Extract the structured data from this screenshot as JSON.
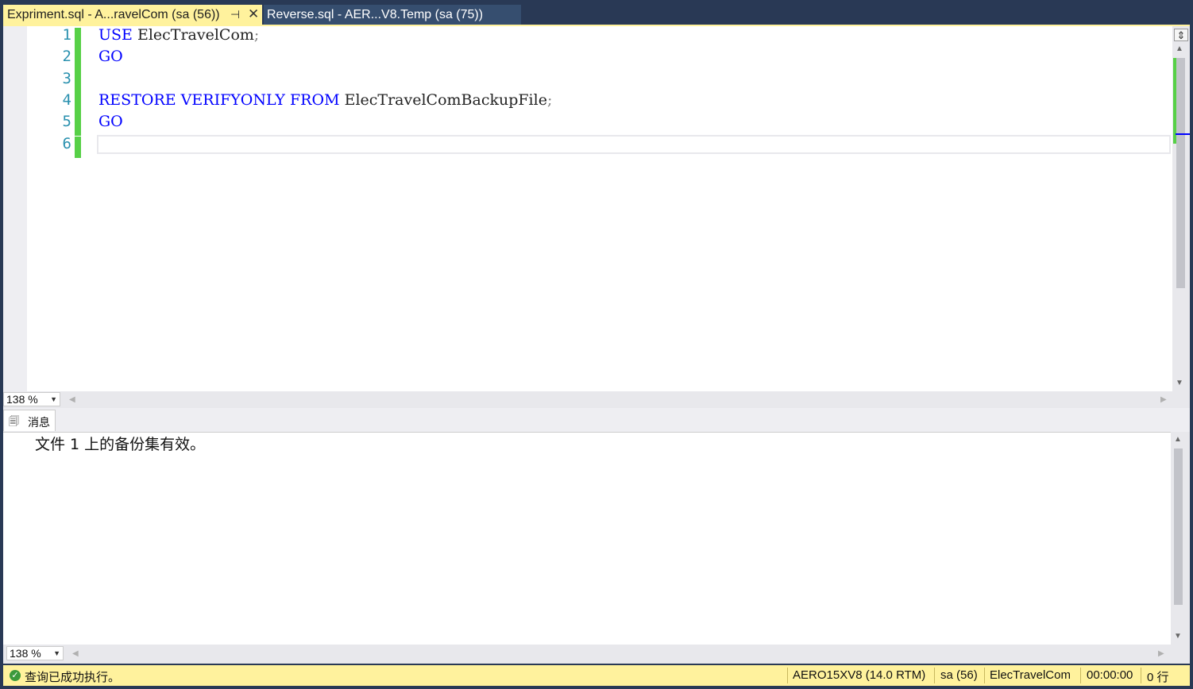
{
  "tabs": {
    "active": {
      "title": "Expriment.sql - A...ravelCom (sa (56))",
      "pin_icon": "pin-icon",
      "close_icon": "close-icon"
    },
    "inactive": {
      "title": "Reverse.sql - AER...V8.Temp (sa (75))"
    }
  },
  "editor": {
    "line_numbers": [
      "1",
      "2",
      "3",
      "4",
      "5",
      "6"
    ],
    "lines": [
      {
        "tokens": [
          {
            "t": "USE",
            "k": true
          },
          {
            "t": " ElecTravelCom",
            "k": false
          },
          {
            "t": ";",
            "p": true
          }
        ]
      },
      {
        "tokens": [
          {
            "t": "GO",
            "k": true
          }
        ]
      },
      {
        "tokens": []
      },
      {
        "tokens": [
          {
            "t": "RESTORE",
            "k": true
          },
          {
            "t": " ",
            "k": false
          },
          {
            "t": "VERIFYONLY",
            "k": true
          },
          {
            "t": " ",
            "k": false
          },
          {
            "t": "FROM",
            "k": true
          },
          {
            "t": " ElecTravelComBackupFile",
            "k": false
          },
          {
            "t": ";",
            "p": true
          }
        ]
      },
      {
        "tokens": [
          {
            "t": "GO",
            "k": true
          }
        ]
      },
      {
        "tokens": []
      }
    ],
    "zoom": "138 %"
  },
  "results": {
    "tab_label": "消息",
    "message": "文件 1 上的备份集有效。",
    "zoom": "138 %"
  },
  "status": {
    "message": "查询已成功执行。",
    "server": "AERO15XV8 (14.0 RTM)",
    "user": "sa (56)",
    "database": "ElecTravelCom",
    "elapsed": "00:00:00",
    "rows": "0 行"
  },
  "colors": {
    "accent": "#fff29d",
    "keyword": "#0000ff",
    "line_number": "#2b91af",
    "change_bar": "#57d047",
    "frame": "#293955"
  }
}
